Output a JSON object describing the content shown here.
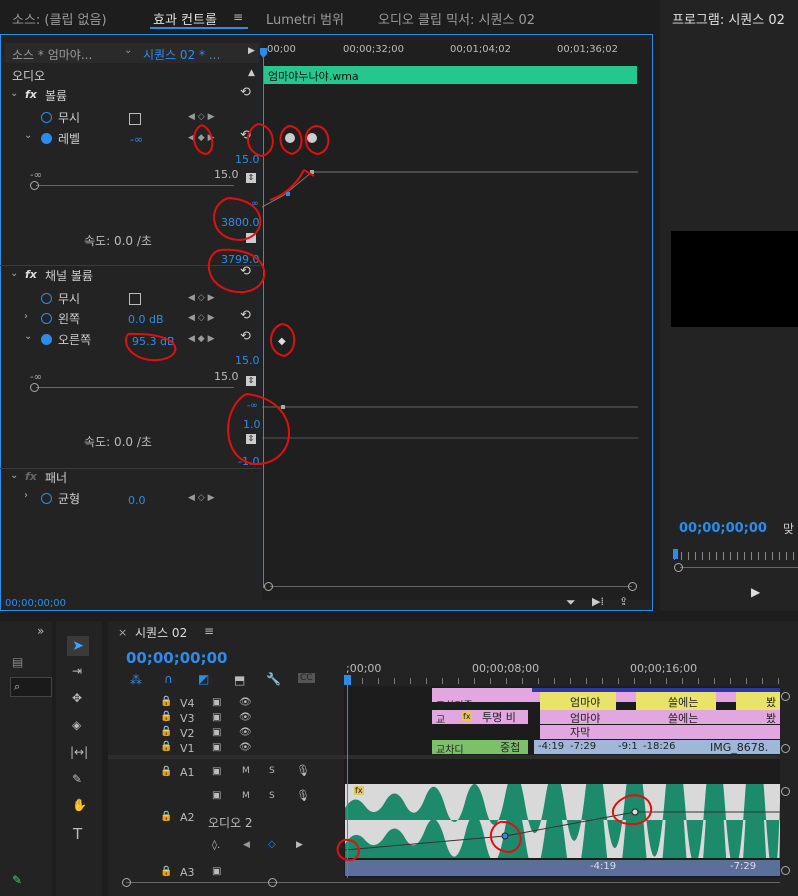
{
  "tabs": {
    "source": "소스: (클립 없음)",
    "effect_controls": "효과 컨트롤",
    "lumetri": "Lumetri 범위",
    "audio_mixer": "오디오 클립 믹서: 시퀀스 02",
    "program": "프로그램: 시퀀스 02"
  },
  "ec": {
    "source_clip": "소스 * 엄마야...",
    "sequence": "시퀀스 02 * ...",
    "ruler": [
      "00;00",
      "00;00;32;00",
      "00;01;04;02",
      "00;01;36;02"
    ],
    "clip_name": "엄마야누나야.wma",
    "audio_header": "오디오",
    "volume": "볼륨",
    "mute": "무시",
    "level": "레벨",
    "level_value": "-∞",
    "graph1_max": "15.0",
    "graph1_slider_left": "-∞",
    "graph1_slider_right": "15.0",
    "graph1_neg": "-∞",
    "graph1_bottom": "3800.0",
    "graph1_under": "3799.0",
    "speed1": "속도: 0.0 /초",
    "channel_volume": "채널 볼륨",
    "mute2": "무시",
    "left": "왼쪽",
    "left_value": "0.0 dB",
    "right": "오른쪽",
    "right_value": "95.3 dB",
    "graph2_max": "15.0",
    "graph2_slider_left": "-∞",
    "graph2_slider_right": "15.0",
    "graph2_neg": "-∞",
    "graph2_mid": "1.0",
    "graph2_bottom": "-1.0",
    "speed2": "속도: 0.0 /초",
    "panner": "패너",
    "balance": "균형",
    "balance_value": "0.0",
    "timecode": "00;00;00;00"
  },
  "program": {
    "timecode": "00;00;00;00",
    "tail": "맞"
  },
  "timeline": {
    "title": "시퀀스 02",
    "timecode": "00;00;00;00",
    "ruler": [
      ";00;00",
      "00;00;08;00",
      "00;00;16;00"
    ],
    "tracks": {
      "v4": "V4",
      "v3": "V3",
      "v2": "V2",
      "v1": "V1",
      "a1": "A1",
      "a2": "A2",
      "a3": "A3"
    },
    "a2_name": "오디오 2",
    "m": "M",
    "s": "S",
    "clips": {
      "c1": "교차디졸",
      "c2": "교",
      "c3": "투명 비",
      "c4": "교차디",
      "c5": "중첩",
      "c6": "엄마야",
      "c7": "엄마야",
      "c8": "자막",
      "c9": "쓸에는",
      "c10": "쓸에는",
      "c11": "봤",
      "c12": "봤",
      "c13": "IMG_8678.",
      "m1": "-4:19",
      "m2": "-7:29",
      "m3": "-9:1",
      "m4": "-18:26",
      "m5": "-4:19",
      "m6": "-7:29"
    }
  }
}
